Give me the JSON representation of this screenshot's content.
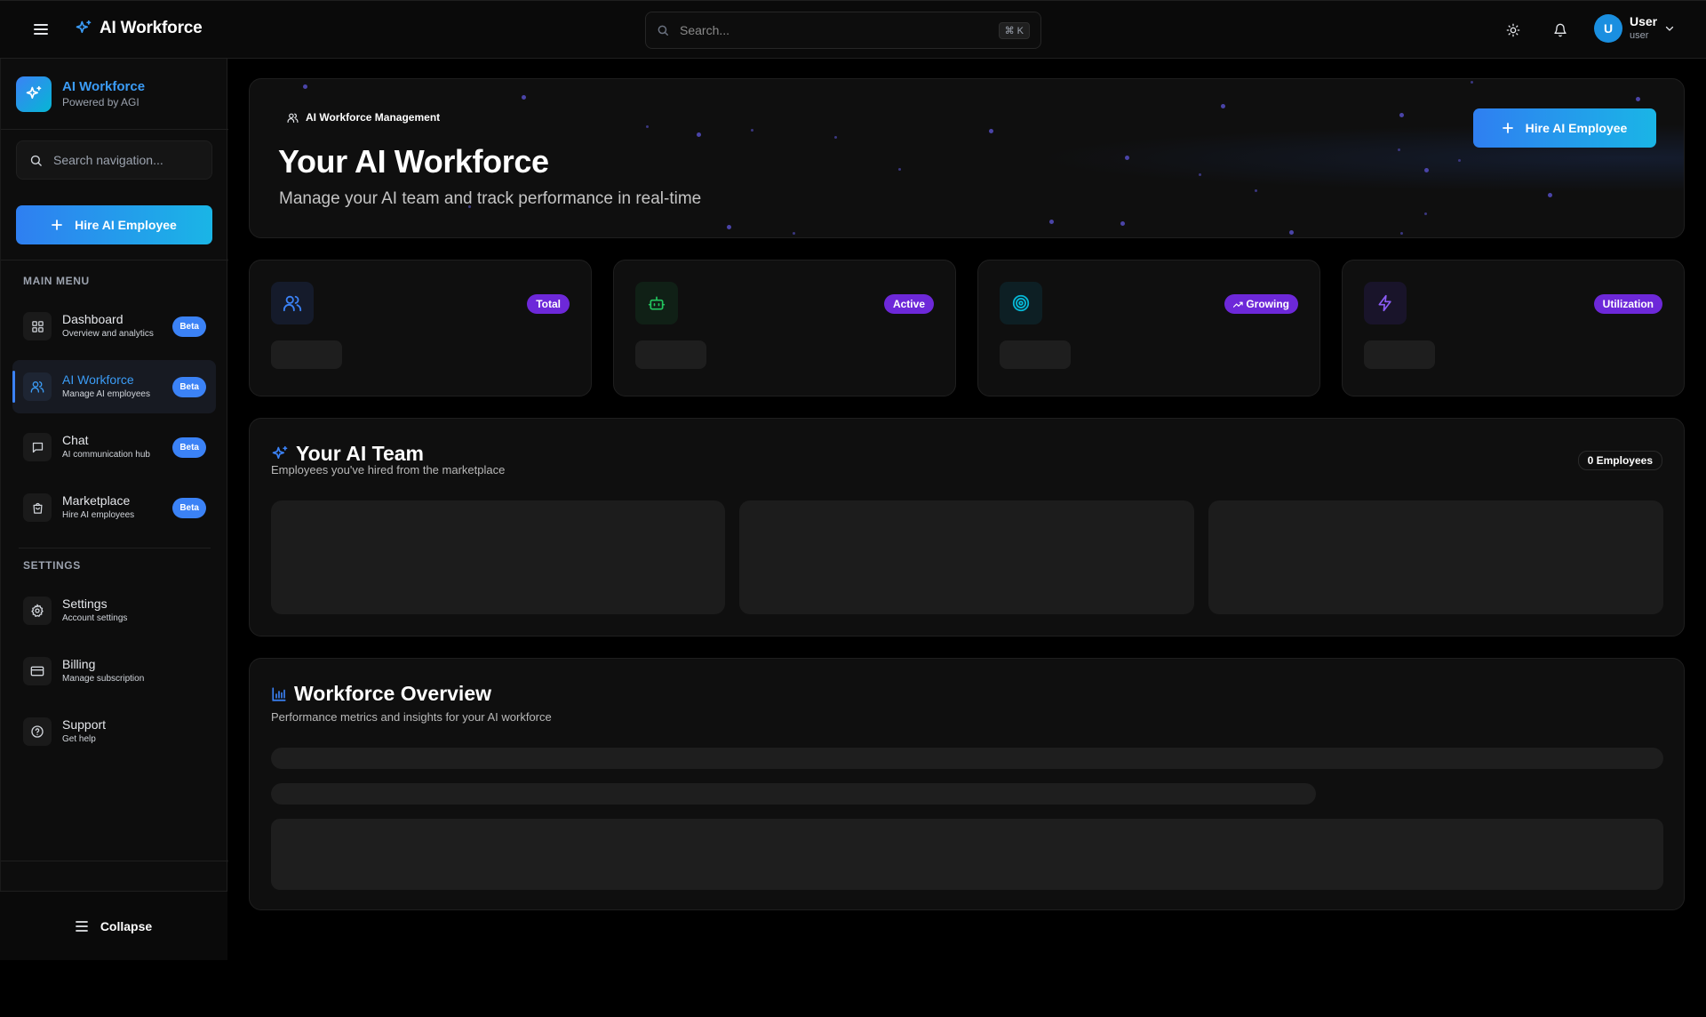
{
  "topbar": {
    "brand": "AI Workforce",
    "search_placeholder": "Search...",
    "shortcut": "⌘ K",
    "user": {
      "initial": "U",
      "name": "User",
      "role": "user"
    }
  },
  "sidebar": {
    "brand_title": "AI Workforce",
    "brand_subtitle": "Powered by AGI",
    "search_placeholder": "Search navigation...",
    "hire_label": "Hire AI Employee",
    "main_menu_label": "MAIN MENU",
    "settings_label": "SETTINGS",
    "main_items": [
      {
        "label": "Dashboard",
        "sub": "Overview and analytics",
        "badge": "Beta",
        "icon": "grid-icon"
      },
      {
        "label": "AI Workforce",
        "sub": "Manage AI employees",
        "badge": "Beta",
        "icon": "users-icon",
        "active": true
      },
      {
        "label": "Chat",
        "sub": "AI communication hub",
        "badge": "Beta",
        "icon": "message-icon"
      },
      {
        "label": "Marketplace",
        "sub": "Hire AI employees",
        "badge": "Beta",
        "icon": "shopping-bag-icon"
      }
    ],
    "settings_items": [
      {
        "label": "Settings",
        "sub": "Account settings",
        "icon": "gear-icon"
      },
      {
        "label": "Billing",
        "sub": "Manage subscription",
        "icon": "credit-card-icon"
      },
      {
        "label": "Support",
        "sub": "Get help",
        "icon": "help-circle-icon"
      }
    ],
    "collapse_label": "Collapse"
  },
  "hero": {
    "chip": "AI Workforce Management",
    "title": "Your AI Workforce",
    "subtitle": "Manage your AI team and track performance in real-time",
    "button": "Hire AI Employee"
  },
  "stats": [
    {
      "badge": "Total",
      "icon": "users-icon",
      "color": "#3b82f6"
    },
    {
      "badge": "Active",
      "icon": "bot-icon",
      "color": "#22c55e"
    },
    {
      "badge": "Growing",
      "icon": "target-icon",
      "color": "#06b6d4"
    },
    {
      "badge": "Utilization",
      "icon": "zap-icon",
      "color": "#8b5cf6"
    }
  ],
  "team": {
    "title": "Your AI Team",
    "subtitle": "Employees you've hired from the marketplace",
    "count": "0 Employees"
  },
  "overview": {
    "title": "Workforce Overview",
    "subtitle": "Performance metrics and insights for your AI workforce"
  },
  "colors": {
    "accent": "#3b82f6",
    "badge_purple": "#6d28d9",
    "gradient_start": "#2f7ff1",
    "gradient_end": "#1ab5e6"
  }
}
